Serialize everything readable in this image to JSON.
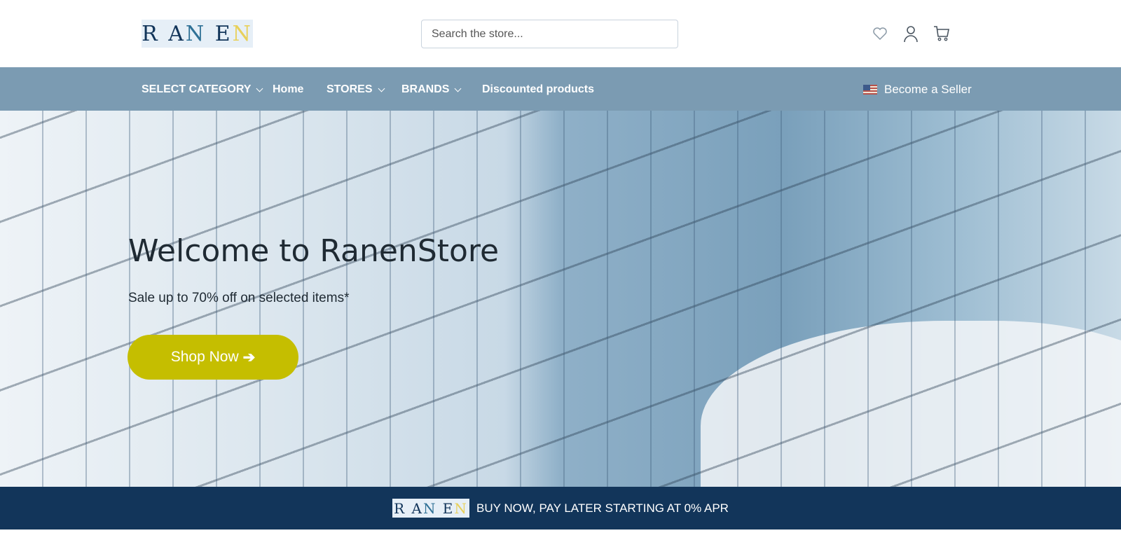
{
  "header": {
    "logo_text": "RANEN",
    "search_placeholder": "Search the store..."
  },
  "icons": [
    "heart-icon",
    "user-icon",
    "cart-icon"
  ],
  "nav": {
    "items": [
      {
        "label": "SELECT CATEGORY",
        "dropdown": true
      },
      {
        "label": "Home"
      },
      {
        "label": "STORES",
        "dropdown": true
      },
      {
        "label": "BRANDS",
        "dropdown": true
      },
      {
        "label": "Discounted products"
      }
    ],
    "seller": "Become a Seller"
  },
  "hero": {
    "title": "Welcome to RanenStore",
    "subtitle": "Sale up to 70% off on selected items*",
    "button": "Shop Now"
  },
  "promo": {
    "logo_text": "RANEN",
    "text": "BUY NOW, PAY LATER STARTING AT 0% APR"
  },
  "colors": {
    "nav": "#7b9bb2",
    "accent": "#c5be00",
    "promo": "#12355a"
  }
}
